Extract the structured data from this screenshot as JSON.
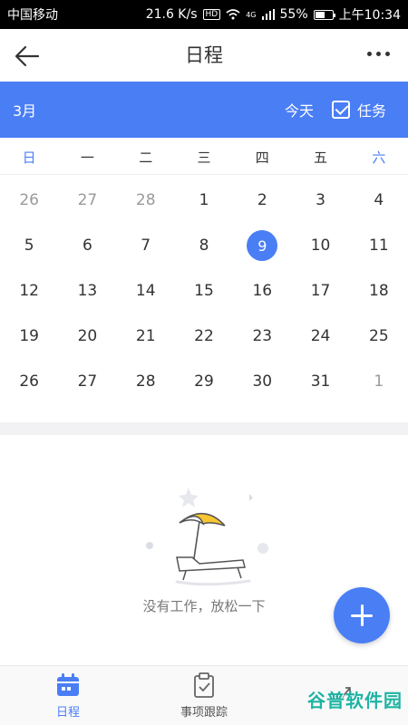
{
  "status_bar": {
    "carrier": "中国移动",
    "speed": "21.6 K/s",
    "hd": "HD",
    "network": "4G",
    "battery": "55%",
    "battery_level": 0.55,
    "time": "上午10:34"
  },
  "app_bar": {
    "title": "日程"
  },
  "month_bar": {
    "month": "3月",
    "today_label": "今天",
    "task_label": "任务",
    "task_checked": true
  },
  "weekdays": [
    "日",
    "一",
    "二",
    "三",
    "四",
    "五",
    "六"
  ],
  "calendar": {
    "weeks": [
      [
        {
          "d": "26",
          "m": true
        },
        {
          "d": "27",
          "m": true
        },
        {
          "d": "28",
          "m": true
        },
        {
          "d": "1"
        },
        {
          "d": "2"
        },
        {
          "d": "3"
        },
        {
          "d": "4"
        }
      ],
      [
        {
          "d": "5"
        },
        {
          "d": "6"
        },
        {
          "d": "7"
        },
        {
          "d": "8"
        },
        {
          "d": "9",
          "sel": true
        },
        {
          "d": "10"
        },
        {
          "d": "11"
        }
      ],
      [
        {
          "d": "12"
        },
        {
          "d": "13"
        },
        {
          "d": "14"
        },
        {
          "d": "15"
        },
        {
          "d": "16"
        },
        {
          "d": "17"
        },
        {
          "d": "18"
        }
      ],
      [
        {
          "d": "19"
        },
        {
          "d": "20"
        },
        {
          "d": "21"
        },
        {
          "d": "22"
        },
        {
          "d": "23"
        },
        {
          "d": "24"
        },
        {
          "d": "25"
        }
      ],
      [
        {
          "d": "26"
        },
        {
          "d": "27"
        },
        {
          "d": "28"
        },
        {
          "d": "29"
        },
        {
          "d": "30"
        },
        {
          "d": "31"
        },
        {
          "d": "1",
          "m": true
        }
      ]
    ]
  },
  "empty_state": {
    "message": "没有工作，放松一下"
  },
  "bottom_nav": {
    "items": [
      {
        "label": "日程",
        "icon": "calendar-icon",
        "active": true
      },
      {
        "label": "事项跟踪",
        "icon": "clipboard-check-icon",
        "active": false
      },
      {
        "label": "",
        "icon": "trend-chart-icon",
        "active": false
      }
    ]
  },
  "watermark": "谷普软件园",
  "colors": {
    "accent": "#4a7ef5",
    "umbrella": "#f7c531"
  }
}
